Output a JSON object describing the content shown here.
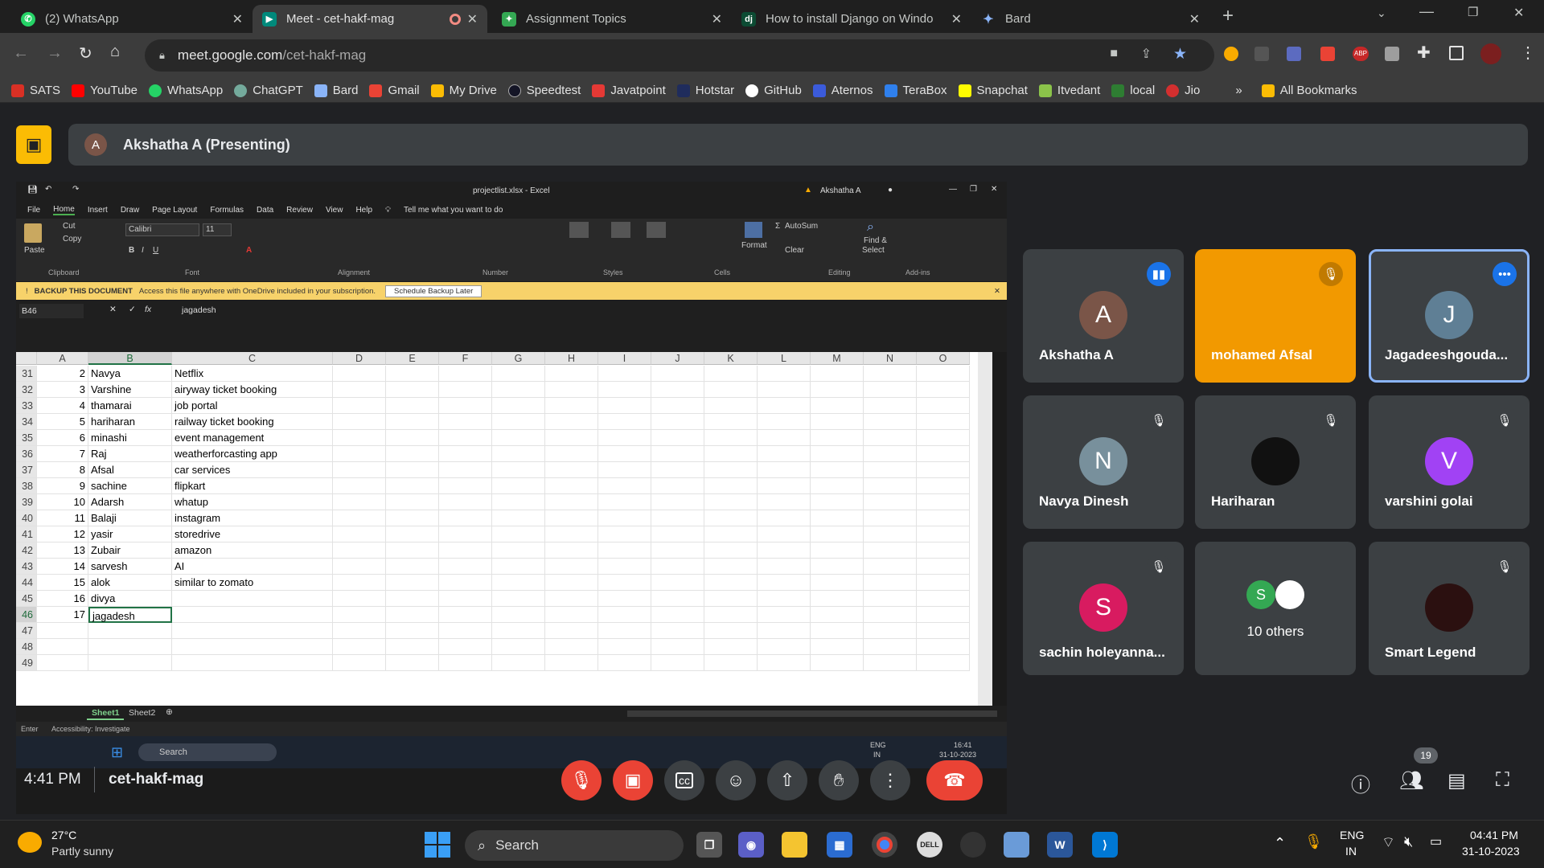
{
  "browser": {
    "tabs": [
      {
        "label": "(2) WhatsApp",
        "icon": "whatsapp-icon",
        "color": "#25d366"
      },
      {
        "label": "Meet - cet-hakf-mag",
        "icon": "meet-icon",
        "color": "#00897b"
      },
      {
        "label": "Assignment Topics",
        "icon": "sheet-icon",
        "color": "#34a853"
      },
      {
        "label": "How to install Django on Windo",
        "icon": "django-icon",
        "color": "#0c4b33"
      },
      {
        "label": "Bard",
        "icon": "bard-icon",
        "color": "#8ab4f8"
      }
    ],
    "url_host": "meet.google.com",
    "url_path": "/cet-hakf-mag",
    "bookmarks": [
      {
        "label": "SATS",
        "color": "#d93025"
      },
      {
        "label": "YouTube",
        "color": "#ff0000"
      },
      {
        "label": "WhatsApp",
        "color": "#25d366"
      },
      {
        "label": "ChatGPT",
        "color": "#74aa9c"
      },
      {
        "label": "Bard",
        "color": "#8ab4f8"
      },
      {
        "label": "Gmail",
        "color": "#ea4335"
      },
      {
        "label": "My Drive",
        "color": "#fbbc04"
      },
      {
        "label": "Speedtest",
        "color": "#141526"
      },
      {
        "label": "Javatpoint",
        "color": "#e53935"
      },
      {
        "label": "Hotstar",
        "color": "#1f2c5c"
      },
      {
        "label": "GitHub",
        "color": "#ffffff"
      },
      {
        "label": "Aternos",
        "color": "#3b5bdb"
      },
      {
        "label": "TeraBox",
        "color": "#2f80ed"
      },
      {
        "label": "Snapchat",
        "color": "#fffc00"
      },
      {
        "label": "Itvedant",
        "color": "#8bc34a"
      },
      {
        "label": "local",
        "color": "#2e7d32"
      },
      {
        "label": "Jio",
        "color": "#d32f2f"
      }
    ],
    "more": "»",
    "all_bookmarks": "All Bookmarks"
  },
  "meet": {
    "presenter_initial": "A",
    "presenter": "Akshatha A (Presenting)",
    "time": "4:41 PM",
    "code": "cet-hakf-mag",
    "participant_count": "19",
    "tiles": [
      {
        "name": "Akshatha A",
        "initial": "A",
        "avatar_color": "#7a5548",
        "bg": "#3c4043",
        "state": "speaking"
      },
      {
        "name": "mohamed Afsal",
        "initial": "",
        "avatar_color": "",
        "bg": "#f29900",
        "state": "muted"
      },
      {
        "name": "Jagadeeshgouda...",
        "initial": "J",
        "avatar_color": "#5f7f95",
        "bg": "#3c4043",
        "state": "more"
      },
      {
        "name": "Navya Dinesh",
        "initial": "N",
        "avatar_color": "#78909c",
        "bg": "#3c4043",
        "state": "muted"
      },
      {
        "name": "Hariharan",
        "initial": "",
        "avatar_color": "#111111",
        "bg": "#3c4043",
        "state": "muted"
      },
      {
        "name": "varshini golai",
        "initial": "V",
        "avatar_color": "#a142f4",
        "bg": "#3c4043",
        "state": "muted"
      },
      {
        "name": "sachin holeyanna...",
        "initial": "S",
        "avatar_color": "#d81b60",
        "bg": "#3c4043",
        "state": "muted"
      },
      {
        "name": "10 others",
        "initial": "S",
        "avatar_color": "#34a853",
        "bg": "#3c4043",
        "state": "none"
      },
      {
        "name": "Smart Legend",
        "initial": "",
        "avatar_color": "#2b1010",
        "bg": "#3c4043",
        "state": "muted"
      }
    ]
  },
  "excel": {
    "title": "projectlist.xlsx - Excel",
    "user": "Akshatha A",
    "menu": [
      "File",
      "Home",
      "Insert",
      "Draw",
      "Page Layout",
      "Formulas",
      "Data",
      "Review",
      "View",
      "Help"
    ],
    "tell_me": "Tell me what you want to do",
    "ribbon": {
      "cut": "Cut",
      "copy": "Copy",
      "paste": "Paste",
      "font": "Calibri",
      "size": "11",
      "autosum": "AutoSum",
      "clear": "Clear",
      "format": "Format",
      "find": "Find &",
      "select": "Select",
      "groups": [
        "Clipboard",
        "Font",
        "Alignment",
        "Number",
        "Styles",
        "Cells",
        "Editing",
        "Add-ins"
      ]
    },
    "message_label": "BACKUP THIS DOCUMENT",
    "message_text": "Access this file anywhere with OneDrive included in your subscription.",
    "message_button": "Schedule Backup Later",
    "namebox": "B46",
    "formula": "jagadesh",
    "columns": [
      "A",
      "B",
      "C",
      "D",
      "E",
      "F",
      "G",
      "H",
      "I",
      "J",
      "K",
      "L",
      "M",
      "N",
      "O"
    ],
    "rows": [
      {
        "n": "31",
        "a": "2",
        "b": "Navya",
        "c": "Netflix"
      },
      {
        "n": "32",
        "a": "3",
        "b": "Varshine",
        "c": "airyway ticket booking"
      },
      {
        "n": "33",
        "a": "4",
        "b": "thamarai",
        "c": "job portal"
      },
      {
        "n": "34",
        "a": "5",
        "b": "hariharan",
        "c": "railway ticket booking"
      },
      {
        "n": "35",
        "a": "6",
        "b": "minashi",
        "c": "event management"
      },
      {
        "n": "36",
        "a": "7",
        "b": "Raj",
        "c": "weatherforcasting app"
      },
      {
        "n": "37",
        "a": "8",
        "b": "Afsal",
        "c": "car services"
      },
      {
        "n": "38",
        "a": "9",
        "b": "sachine",
        "c": "flipkart"
      },
      {
        "n": "39",
        "a": "10",
        "b": "Adarsh",
        "c": "whatup"
      },
      {
        "n": "40",
        "a": "11",
        "b": "Balaji",
        "c": "instagram"
      },
      {
        "n": "41",
        "a": "12",
        "b": "yasir",
        "c": "storedrive"
      },
      {
        "n": "42",
        "a": "13",
        "b": "Zubair",
        "c": "amazon"
      },
      {
        "n": "43",
        "a": "14",
        "b": "sarvesh",
        "c": "AI"
      },
      {
        "n": "44",
        "a": "15",
        "b": "alok",
        "c": "similar to zomato"
      },
      {
        "n": "45",
        "a": "16",
        "b": "divya",
        "c": ""
      },
      {
        "n": "46",
        "a": "17",
        "b": "jagadesh",
        "c": ""
      },
      {
        "n": "47",
        "a": "",
        "b": "",
        "c": ""
      },
      {
        "n": "48",
        "a": "",
        "b": "",
        "c": ""
      },
      {
        "n": "49",
        "a": "",
        "b": "",
        "c": ""
      }
    ],
    "sheets": [
      "Sheet1",
      "Sheet2"
    ],
    "status_mode": "Enter",
    "status_access": "Accessibility: Investigate",
    "inner_taskbar": {
      "search": "Search",
      "lang": "ENG",
      "region": "IN",
      "time": "16:41",
      "date": "31-10-2023"
    }
  },
  "taskbar": {
    "temp": "27°C",
    "weather": "Partly sunny",
    "search": "Search",
    "lang": "ENG",
    "region": "IN",
    "time": "04:41 PM",
    "date": "31-10-2023"
  }
}
